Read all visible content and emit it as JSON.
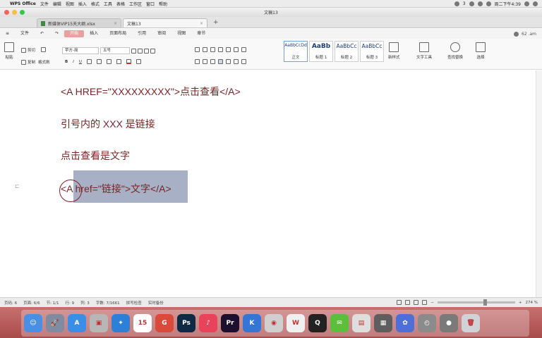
{
  "menubar": {
    "app": "WPS Office",
    "items": [
      "文件",
      "编辑",
      "视图",
      "插入",
      "格式",
      "工具",
      "表格",
      "工作区",
      "窗口",
      "帮助"
    ],
    "badge": "3",
    "clock": "周二下午4:39"
  },
  "window": {
    "title": "文稿13"
  },
  "tabs": [
    {
      "label": "新媒体VIP15天大纲.xlsx",
      "active": false,
      "type": "sheet"
    },
    {
      "label": "文稿13",
      "active": true,
      "type": "doc"
    }
  ],
  "tab_add": "+",
  "ribbon_menu": {
    "items": [
      "文件",
      "开始",
      "插入",
      "页面布局",
      "引用",
      "审阅",
      "视图",
      "章节"
    ],
    "active": "开始",
    "right_label": "62 .am"
  },
  "toolbar": {
    "paste": "粘贴",
    "cut": "剪切",
    "copy": "复制",
    "format_painter": "格式刷",
    "font_family": "苹方-简",
    "font_size": "五号",
    "bold": "B",
    "italic": "I",
    "underline": "U",
    "styles": [
      {
        "preview": "AaBbCcDd",
        "name": "正文"
      },
      {
        "preview": "AaBb",
        "name": "标题 1"
      },
      {
        "preview": "AaBbCc",
        "name": "标题 2"
      },
      {
        "preview": "AaBbCc",
        "name": "标题 3"
      }
    ],
    "new_style": "新样式",
    "text_tools": "文字工具",
    "find_replace": "查找替换",
    "select": "选择"
  },
  "document": {
    "lines": [
      "<A HREF=\"XXXXXXXXX\">点击查看</A>",
      "引号内的 XXX 是链接",
      "点击查看是文字",
      "<A href=\"链接\">文字</A>"
    ]
  },
  "statusbar": {
    "page_num": "页码: 6",
    "page": "页面: 6/6",
    "section": "节: 1/1",
    "row": "行: 9",
    "col": "列: 3",
    "word_count": "字数: 7/1661",
    "spell_check": "拼写检查",
    "backup": "实时备份",
    "zoom": "274 %",
    "zoom_level": 0.62
  },
  "dock": {
    "apps": [
      {
        "name": "Finder",
        "glyph": "☺",
        "color": "#4a8fe3"
      },
      {
        "name": "Launchpad",
        "glyph": "🚀",
        "color": "#7f8ba0"
      },
      {
        "name": "App Store",
        "glyph": "A",
        "color": "#3a8ee6"
      },
      {
        "name": "Preview",
        "glyph": "▣",
        "color": "#b7b7b7"
      },
      {
        "name": "Safari",
        "glyph": "✦",
        "color": "#2e7fd8"
      },
      {
        "name": "Calendar",
        "glyph": "15",
        "color": "#ffffff"
      },
      {
        "name": "PDF",
        "glyph": "G",
        "color": "#d94a3a"
      },
      {
        "name": "Photoshop",
        "glyph": "Ps",
        "color": "#0f2a44"
      },
      {
        "name": "Music",
        "glyph": "♪",
        "color": "#e9435c"
      },
      {
        "name": "Premiere",
        "glyph": "Pr",
        "color": "#1c0f2f"
      },
      {
        "name": "Keynote",
        "glyph": "K",
        "color": "#3575d6"
      },
      {
        "name": "Chrome",
        "glyph": "◉",
        "color": "#cfcfcf"
      },
      {
        "name": "Word",
        "glyph": "W",
        "color": "#f0f0f0"
      },
      {
        "name": "QQ",
        "glyph": "Q",
        "color": "#222222"
      },
      {
        "name": "WeChat",
        "glyph": "✉",
        "color": "#5bbf3c"
      },
      {
        "name": "Notes",
        "glyph": "▤",
        "color": "#dedede"
      },
      {
        "name": "Archive",
        "glyph": "▦",
        "color": "#5e5e5e"
      },
      {
        "name": "Baidu",
        "glyph": "✿",
        "color": "#4f6fd8"
      },
      {
        "name": "Screen Recorder",
        "glyph": "◴",
        "color": "#8b8b8b"
      },
      {
        "name": "Downloads",
        "glyph": "●",
        "color": "#7a7a7a"
      },
      {
        "name": "Trash",
        "glyph": "🗑",
        "color": "#cfd3d8"
      }
    ]
  },
  "colors": {
    "doc_text": "#7a2426",
    "selection": "#a7b0c4",
    "annotation_circle": "#8a1d1f",
    "dock_background": "#b35a5a"
  }
}
